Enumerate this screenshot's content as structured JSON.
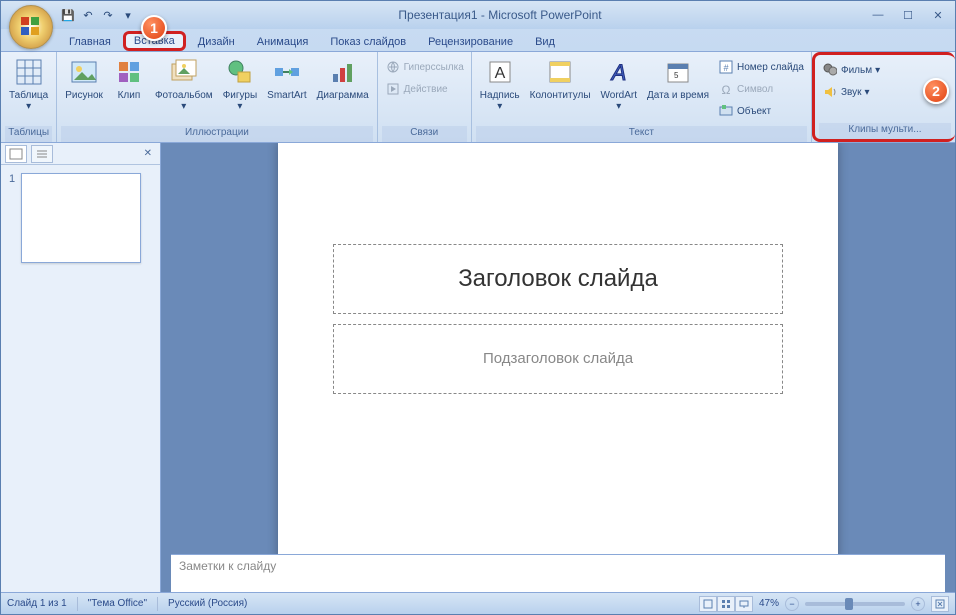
{
  "title": "Презентация1 - Microsoft PowerPoint",
  "qat": {
    "save": "💾",
    "undo": "↶",
    "redo": "↷",
    "dd": "▾"
  },
  "tabs": {
    "home": "Главная",
    "insert": "Вставка",
    "design": "Дизайн",
    "anim": "Анимация",
    "show": "Показ слайдов",
    "review": "Рецензирование",
    "view": "Вид"
  },
  "ribbon": {
    "tables": {
      "label": "Таблицы",
      "table": "Таблица"
    },
    "illus": {
      "label": "Иллюстрации",
      "picture": "Рисунок",
      "clip": "Клип",
      "album": "Фотоальбом",
      "shapes": "Фигуры",
      "smartart": "SmartArt",
      "chart": "Диаграмма"
    },
    "links": {
      "label": "Связи",
      "hyper": "Гиперссылка",
      "action": "Действие"
    },
    "text": {
      "label": "Текст",
      "textbox": "Надпись",
      "hf": "Колонтитулы",
      "wordart": "WordArt",
      "datetime": "Дата и время",
      "slidenum": "Номер слайда",
      "symbol": "Символ",
      "object": "Объект"
    },
    "media": {
      "label": "Клипы мульти...",
      "movie": "Фильм",
      "sound": "Звук"
    }
  },
  "callouts": {
    "c1": "1",
    "c2": "2"
  },
  "slide": {
    "title": "Заголовок слайда",
    "subtitle": "Подзаголовок слайда"
  },
  "notes": "Заметки к слайду",
  "thumb_num": "1",
  "status": {
    "slide": "Слайд 1 из 1",
    "theme": "\"Тема Office\"",
    "lang": "Русский (Россия)",
    "zoom": "47%"
  }
}
